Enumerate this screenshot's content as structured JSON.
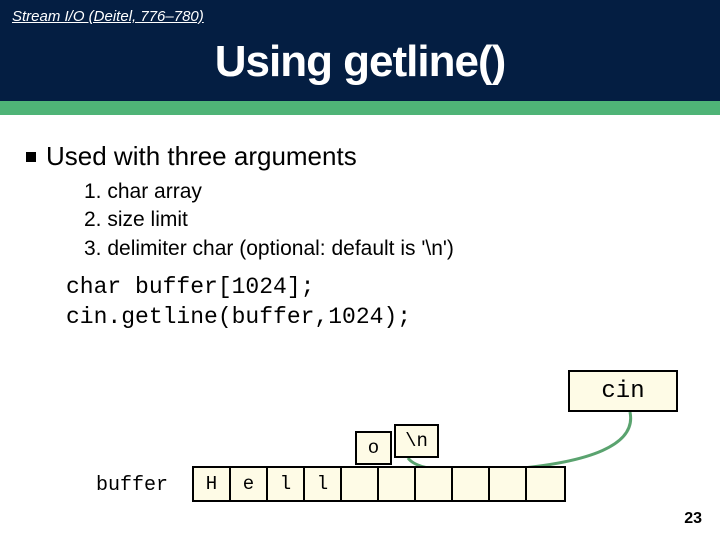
{
  "header": {
    "breadcrumb": "Stream I/O (Deitel, 776–780)",
    "title": "Using getline()"
  },
  "bullet": {
    "text": "Used with three arguments"
  },
  "args": [
    {
      "n": "1.",
      "label": "char array"
    },
    {
      "n": "2.",
      "label": "size limit"
    },
    {
      "n": "3.",
      "label": "delimiter char (optional: default is '\\n')"
    }
  ],
  "code": {
    "line1": "char buffer[1024];",
    "line2": "cin.getline(buffer,1024);"
  },
  "diagram": {
    "cin_label": "cin",
    "buffer_label": "buffer",
    "cells": [
      "H",
      "e",
      "l",
      "l",
      "",
      "",
      "",
      "",
      "",
      ""
    ],
    "float_o": "o",
    "float_n": "\\n"
  },
  "page_number": "23"
}
